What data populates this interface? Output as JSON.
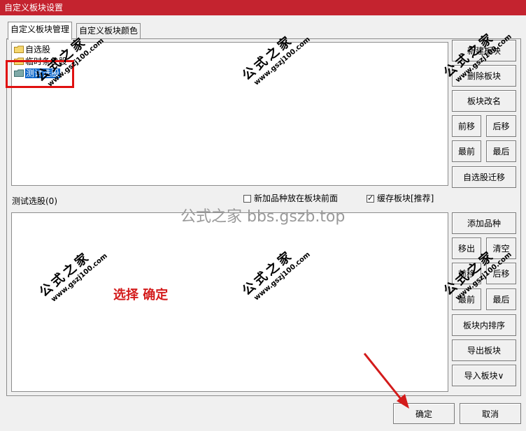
{
  "window": {
    "title": "自定义板块设置"
  },
  "tabs": [
    {
      "label": "自定义板块管理",
      "active": true
    },
    {
      "label": "自定义板块颜色",
      "active": false
    }
  ],
  "block_list": [
    {
      "label": "自选股",
      "selected": false
    },
    {
      "label": "临时条件股",
      "selected": false
    },
    {
      "label": "测试选股",
      "selected": true
    }
  ],
  "top_buttons": {
    "new": "新建板块",
    "delete": "删除板块",
    "rename": "板块改名",
    "move_up": "前移",
    "move_down": "后移",
    "first": "最前",
    "last": "最后",
    "migrate": "自选股迁移"
  },
  "section": {
    "label": "测试选股(0)",
    "new_item_front": {
      "label": "新加品种放在板块前面",
      "checked": false
    },
    "cache_block": {
      "label": "缓存板块[推荐]",
      "checked": true
    }
  },
  "bottom_buttons": {
    "add": "添加品种",
    "remove": "移出",
    "clear": "清空",
    "move_up": "前移",
    "move_down": "后移",
    "first": "最前",
    "last": "最后",
    "sort": "板块内排序",
    "export": "导出板块",
    "import": "导入板块∨"
  },
  "dialog_buttons": {
    "ok": "确定",
    "cancel": "取消"
  },
  "overlay": {
    "center_watermark": "公式之家 bbs.gszb.top",
    "annotation": "选择  确定",
    "stamp_text": "公式之家",
    "stamp_url": "www.gszj100.com"
  },
  "colors": {
    "titlebar": "#c4232f",
    "selection": "#0a64c8",
    "annotation": "#d31b1b"
  }
}
